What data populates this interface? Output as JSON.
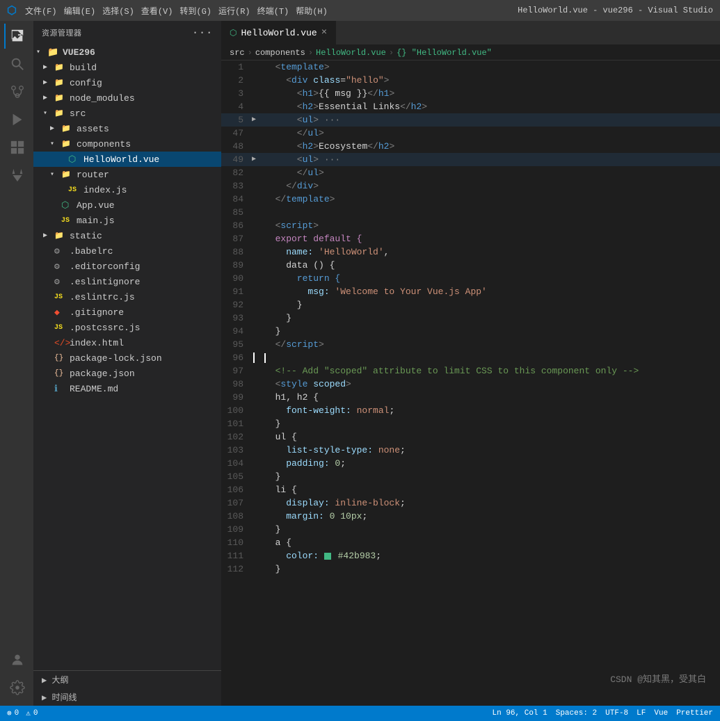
{
  "titleBar": {
    "logo": "⬡",
    "menus": [
      "文件(F)",
      "编辑(E)",
      "选择(S)",
      "查看(V)",
      "转到(G)",
      "运行(R)",
      "终端(T)",
      "帮助(H)"
    ],
    "title": "HelloWorld.vue - vue296 - Visual Studio"
  },
  "activityBar": {
    "icons": [
      {
        "name": "explorer-icon",
        "symbol": "⎘",
        "active": true
      },
      {
        "name": "search-icon",
        "symbol": "🔍",
        "active": false
      },
      {
        "name": "source-control-icon",
        "symbol": "⑂",
        "active": false
      },
      {
        "name": "run-icon",
        "symbol": "▶",
        "active": false
      },
      {
        "name": "extensions-icon",
        "symbol": "⊞",
        "active": false
      },
      {
        "name": "test-icon",
        "symbol": "⚗",
        "active": false
      }
    ],
    "bottomIcons": [
      {
        "name": "account-icon",
        "symbol": "👤"
      },
      {
        "name": "settings-icon",
        "symbol": "⚙"
      }
    ]
  },
  "sidebar": {
    "header": "资源管理器",
    "dotsLabel": "···",
    "projectName": "VUE296",
    "treeItems": [
      {
        "id": "build",
        "label": "build",
        "type": "folder",
        "indent": 1,
        "collapsed": true
      },
      {
        "id": "config",
        "label": "config",
        "type": "folder",
        "indent": 1,
        "collapsed": true
      },
      {
        "id": "node_modules",
        "label": "node_modules",
        "type": "folder",
        "indent": 1,
        "collapsed": true
      },
      {
        "id": "src",
        "label": "src",
        "type": "folder",
        "indent": 1,
        "collapsed": false
      },
      {
        "id": "assets",
        "label": "assets",
        "type": "folder",
        "indent": 2,
        "collapsed": true
      },
      {
        "id": "components",
        "label": "components",
        "type": "folder",
        "indent": 2,
        "collapsed": false
      },
      {
        "id": "HelloWorld",
        "label": "HelloWorld.vue",
        "type": "vue",
        "indent": 3,
        "selected": true
      },
      {
        "id": "router",
        "label": "router",
        "type": "folder",
        "indent": 2,
        "collapsed": false
      },
      {
        "id": "index.js",
        "label": "index.js",
        "type": "js",
        "indent": 3
      },
      {
        "id": "App.vue",
        "label": "App.vue",
        "type": "vue",
        "indent": 2
      },
      {
        "id": "main.js",
        "label": "main.js",
        "type": "js",
        "indent": 2
      },
      {
        "id": "static",
        "label": "static",
        "type": "folder",
        "indent": 1,
        "collapsed": true
      },
      {
        "id": "babelrc",
        "label": ".babelrc",
        "type": "dot",
        "indent": 1
      },
      {
        "id": "editorconfig",
        "label": ".editorconfig",
        "type": "dot",
        "indent": 1
      },
      {
        "id": "eslintignore",
        "label": ".eslintignore",
        "type": "dot",
        "indent": 1
      },
      {
        "id": "eslintrc",
        "label": ".eslintrc.js",
        "type": "js",
        "indent": 1
      },
      {
        "id": "gitignore",
        "label": ".gitignore",
        "type": "git",
        "indent": 1
      },
      {
        "id": "postcssrc",
        "label": ".postcssrc.js",
        "type": "js",
        "indent": 1
      },
      {
        "id": "index.html",
        "label": "index.html",
        "type": "html",
        "indent": 1
      },
      {
        "id": "package-lock",
        "label": "package-lock.json",
        "type": "json",
        "indent": 1
      },
      {
        "id": "package.json",
        "label": "package.json",
        "type": "json",
        "indent": 1
      },
      {
        "id": "README.md",
        "label": "README.md",
        "type": "info",
        "indent": 1
      }
    ],
    "outline": "大纲",
    "timeline": "时间线"
  },
  "tab": {
    "label": "HelloWorld.vue",
    "closeLabel": "×"
  },
  "breadcrumb": {
    "parts": [
      "src",
      ">",
      "components",
      ">",
      "HelloWorld.vue",
      ">",
      "{} \"HelloWorld.vue\""
    ]
  },
  "codeLines": [
    {
      "num": 1,
      "content": [
        {
          "t": "  <",
          "c": "tag"
        },
        {
          "t": "template",
          "c": "tag-name"
        },
        {
          "t": ">",
          "c": "tag"
        }
      ]
    },
    {
      "num": 2,
      "content": [
        {
          "t": "    <",
          "c": "tag"
        },
        {
          "t": "div ",
          "c": "tag-name"
        },
        {
          "t": "class",
          "c": "attr"
        },
        {
          "t": "=",
          "c": "punct"
        },
        {
          "t": "\"hello\"",
          "c": "string"
        },
        {
          "t": ">",
          "c": "tag"
        }
      ]
    },
    {
      "num": 3,
      "content": [
        {
          "t": "      <",
          "c": "tag"
        },
        {
          "t": "h1",
          "c": "tag-name"
        },
        {
          "t": ">",
          "c": "tag"
        },
        {
          "t": "{{ msg }}",
          "c": "text"
        },
        {
          "t": "</",
          "c": "tag"
        },
        {
          "t": "h1",
          "c": "tag-name"
        },
        {
          "t": ">",
          "c": "tag"
        }
      ]
    },
    {
      "num": 4,
      "content": [
        {
          "t": "      <",
          "c": "tag"
        },
        {
          "t": "h2",
          "c": "tag-name"
        },
        {
          "t": ">",
          "c": "tag"
        },
        {
          "t": "Essential Links",
          "c": "text"
        },
        {
          "t": "</",
          "c": "tag"
        },
        {
          "t": "h2",
          "c": "tag-name"
        },
        {
          "t": ">",
          "c": "tag"
        }
      ]
    },
    {
      "num": 5,
      "content": [
        {
          "t": "      <",
          "c": "tag"
        },
        {
          "t": "ul",
          "c": "tag-name"
        },
        {
          "t": "> ···",
          "c": "tag"
        }
      ],
      "hasArrow": true,
      "highlighted": true
    },
    {
      "num": 47,
      "content": [
        {
          "t": "      </",
          "c": "tag"
        },
        {
          "t": "ul",
          "c": "tag-name"
        },
        {
          "t": ">",
          "c": "tag"
        }
      ]
    },
    {
      "num": 48,
      "content": [
        {
          "t": "      <",
          "c": "tag"
        },
        {
          "t": "h2",
          "c": "tag-name"
        },
        {
          "t": ">",
          "c": "tag"
        },
        {
          "t": "Ecosystem",
          "c": "text"
        },
        {
          "t": "</",
          "c": "tag"
        },
        {
          "t": "h2",
          "c": "tag-name"
        },
        {
          "t": ">",
          "c": "tag"
        }
      ]
    },
    {
      "num": 49,
      "content": [
        {
          "t": "      <",
          "c": "tag"
        },
        {
          "t": "ul",
          "c": "tag-name"
        },
        {
          "t": "> ···",
          "c": "tag"
        }
      ],
      "hasArrow": true,
      "highlighted": true
    },
    {
      "num": 82,
      "content": [
        {
          "t": "      </",
          "c": "tag"
        },
        {
          "t": "ul",
          "c": "tag-name"
        },
        {
          "t": ">",
          "c": "tag"
        }
      ]
    },
    {
      "num": 83,
      "content": [
        {
          "t": "    </",
          "c": "tag"
        },
        {
          "t": "div",
          "c": "tag-name"
        },
        {
          "t": ">",
          "c": "tag"
        }
      ]
    },
    {
      "num": 84,
      "content": [
        {
          "t": "  </",
          "c": "tag"
        },
        {
          "t": "template",
          "c": "tag-name"
        },
        {
          "t": ">",
          "c": "tag"
        }
      ]
    },
    {
      "num": 85,
      "content": []
    },
    {
      "num": 86,
      "content": [
        {
          "t": "  <",
          "c": "tag"
        },
        {
          "t": "script",
          "c": "tag-name"
        },
        {
          "t": ">",
          "c": "tag"
        }
      ]
    },
    {
      "num": 87,
      "content": [
        {
          "t": "  export default {",
          "c": "keyword"
        }
      ]
    },
    {
      "num": 88,
      "content": [
        {
          "t": "    name: ",
          "c": "property"
        },
        {
          "t": "'HelloWorld'",
          "c": "string"
        },
        {
          "t": ",",
          "c": "punct"
        }
      ]
    },
    {
      "num": 89,
      "content": [
        {
          "t": "    data () {",
          "c": "text"
        }
      ]
    },
    {
      "num": 90,
      "content": [
        {
          "t": "      return {",
          "c": "keyword2"
        }
      ]
    },
    {
      "num": 91,
      "content": [
        {
          "t": "        msg: ",
          "c": "property"
        },
        {
          "t": "'Welcome to Your Vue.js App'",
          "c": "string"
        }
      ]
    },
    {
      "num": 92,
      "content": [
        {
          "t": "      }",
          "c": "text"
        }
      ]
    },
    {
      "num": 93,
      "content": [
        {
          "t": "    }",
          "c": "text"
        }
      ]
    },
    {
      "num": 94,
      "content": [
        {
          "t": "  }",
          "c": "text"
        }
      ]
    },
    {
      "num": 95,
      "content": [
        {
          "t": "  </",
          "c": "tag"
        },
        {
          "t": "script",
          "c": "tag-name"
        },
        {
          "t": ">",
          "c": "tag"
        }
      ]
    },
    {
      "num": 96,
      "content": [],
      "cursor": true
    },
    {
      "num": 97,
      "content": [
        {
          "t": "  <!-- Add \"scoped\" attribute to limit CSS to this component only -->",
          "c": "comment"
        }
      ]
    },
    {
      "num": 98,
      "content": [
        {
          "t": "  <",
          "c": "tag"
        },
        {
          "t": "style ",
          "c": "tag-name"
        },
        {
          "t": "scoped",
          "c": "attr"
        },
        {
          "t": ">",
          "c": "tag"
        }
      ]
    },
    {
      "num": 99,
      "content": [
        {
          "t": "  h1, h2 {",
          "c": "text"
        }
      ]
    },
    {
      "num": 100,
      "content": [
        {
          "t": "    font-weight: ",
          "c": "property"
        },
        {
          "t": "normal",
          "c": "value"
        },
        {
          "t": ";",
          "c": "punct"
        }
      ]
    },
    {
      "num": 101,
      "content": [
        {
          "t": "  }",
          "c": "text"
        }
      ]
    },
    {
      "num": 102,
      "content": [
        {
          "t": "  ul {",
          "c": "text"
        }
      ]
    },
    {
      "num": 103,
      "content": [
        {
          "t": "    list-style-type: ",
          "c": "property"
        },
        {
          "t": "none",
          "c": "value"
        },
        {
          "t": ";",
          "c": "punct"
        }
      ]
    },
    {
      "num": 104,
      "content": [
        {
          "t": "    padding: ",
          "c": "property"
        },
        {
          "t": "0",
          "c": "number"
        },
        {
          "t": ";",
          "c": "punct"
        }
      ]
    },
    {
      "num": 105,
      "content": [
        {
          "t": "  }",
          "c": "text"
        }
      ]
    },
    {
      "num": 106,
      "content": [
        {
          "t": "  li {",
          "c": "text"
        }
      ]
    },
    {
      "num": 107,
      "content": [
        {
          "t": "    display: ",
          "c": "property"
        },
        {
          "t": "inline-block",
          "c": "value"
        },
        {
          "t": ";",
          "c": "punct"
        }
      ]
    },
    {
      "num": 108,
      "content": [
        {
          "t": "    margin: ",
          "c": "property"
        },
        {
          "t": "0 10px",
          "c": "number"
        },
        {
          "t": ";",
          "c": "punct"
        }
      ]
    },
    {
      "num": 109,
      "content": [
        {
          "t": "  }",
          "c": "text"
        }
      ]
    },
    {
      "num": 110,
      "content": [
        {
          "t": "  a {",
          "c": "text"
        }
      ]
    },
    {
      "num": 111,
      "content": [
        {
          "t": "    color: ",
          "c": "property"
        },
        {
          "t": "■",
          "c": "green-box"
        },
        {
          "t": " #42b983",
          "c": "number"
        },
        {
          "t": ";",
          "c": "punct"
        }
      ]
    },
    {
      "num": 112,
      "content": [
        {
          "t": "  }",
          "c": "text"
        }
      ]
    }
  ],
  "statusBar": {
    "errors": "⊗ 0",
    "warnings": "⚠ 0",
    "rightItems": [
      "Ln 96, Col 1",
      "Spaces: 2",
      "UTF-8",
      "LF",
      "Vue",
      "Prettier"
    ],
    "watermark": "CSDN @知其黑，受其白"
  }
}
